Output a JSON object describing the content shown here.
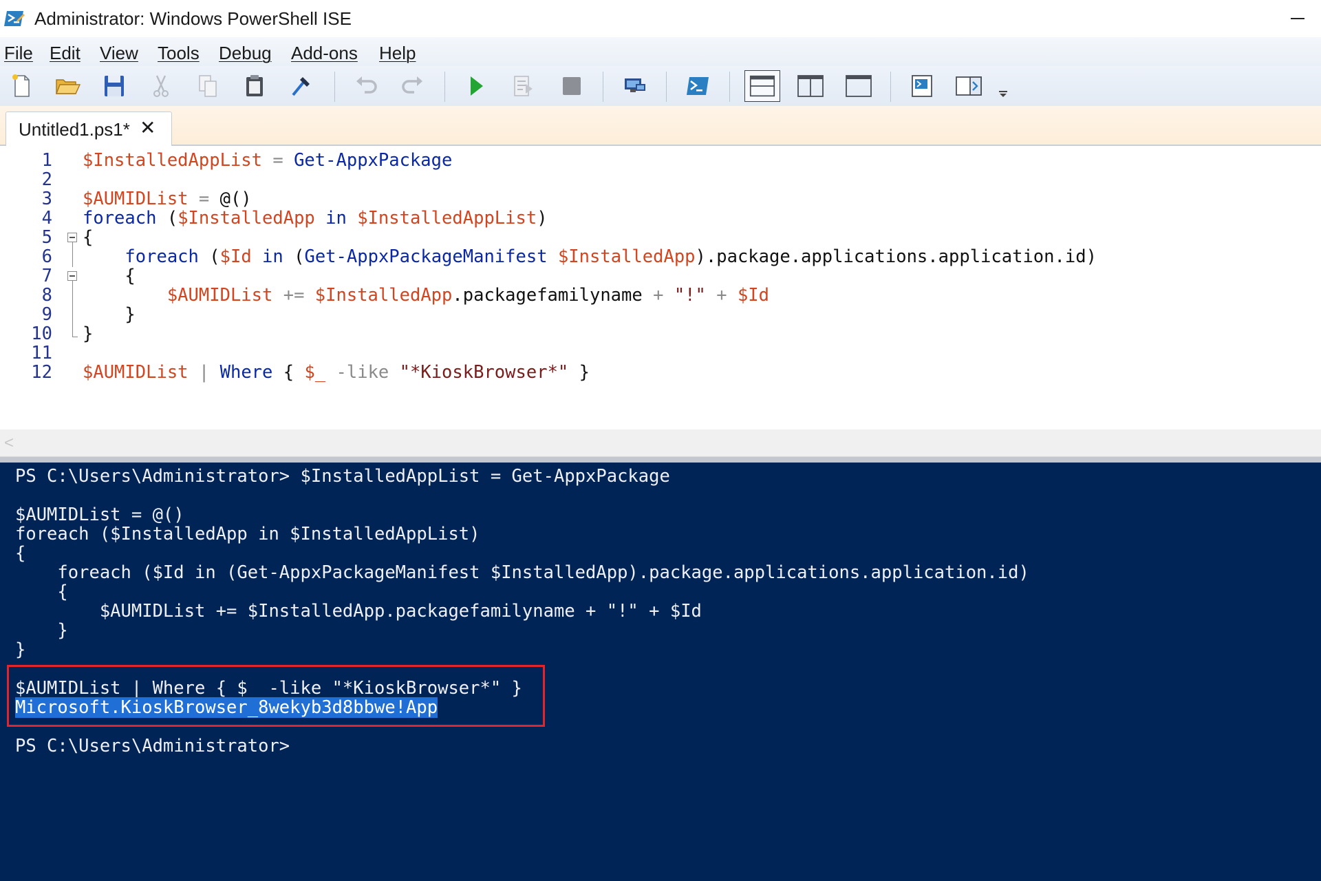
{
  "window": {
    "title": "Administrator: Windows PowerShell ISE"
  },
  "menu": [
    "File",
    "Edit",
    "View",
    "Tools",
    "Debug",
    "Add-ons",
    "Help"
  ],
  "toolbar": {
    "buttons": [
      "new-file",
      "open",
      "save",
      "cut",
      "copy",
      "paste",
      "clear-console",
      "undo",
      "redo",
      "run-script",
      "run-selection",
      "stop",
      "new-remote-tab",
      "start-powershell",
      "show-script-top",
      "show-script-right",
      "show-script-maximized",
      "show-command-window",
      "show-command-addon",
      "customize"
    ],
    "accent_run": "#22a532"
  },
  "tab": {
    "label": "Untitled1.ps1*",
    "close_glyph": "✕"
  },
  "editor": {
    "line_numbers": [
      "1",
      "2",
      "3",
      "4",
      "5",
      "6",
      "7",
      "8",
      "9",
      "10",
      "11",
      "12"
    ],
    "lines": [
      "$InstalledAppList = Get-AppxPackage",
      "",
      "$AUMIDList = @()",
      "foreach ($InstalledApp in $InstalledAppList)",
      "{",
      "    foreach ($Id in (Get-AppxPackageManifest $InstalledApp).package.applications.application.id)",
      "    {",
      "        $AUMIDList += $InstalledApp.packagefamilyname + \"!\" + $Id",
      "    }",
      "}",
      "",
      "$AUMIDList | Where { $_ -like \"*KioskBrowser*\" }"
    ]
  },
  "console": {
    "lines": [
      "PS C:\\Users\\Administrator> $InstalledAppList = Get-AppxPackage",
      "",
      "$AUMIDList = @()",
      "foreach ($InstalledApp in $InstalledAppList)",
      "{",
      "    foreach ($Id in (Get-AppxPackageManifest $InstalledApp).package.applications.application.id)",
      "    {",
      "        $AUMIDList += $InstalledApp.packagefamilyname + \"!\" + $Id",
      "    }",
      "}",
      "",
      "$AUMIDList | Where { $_ -like \"*KioskBrowser*\" }",
      "Microsoft.KioskBrowser_8wekyb3d8bbwe!App",
      "",
      "PS C:\\Users\\Administrator>"
    ],
    "background": "#012456",
    "highlight_color": "#e2242b"
  },
  "scrollbar": {
    "left_arrow": "<"
  }
}
